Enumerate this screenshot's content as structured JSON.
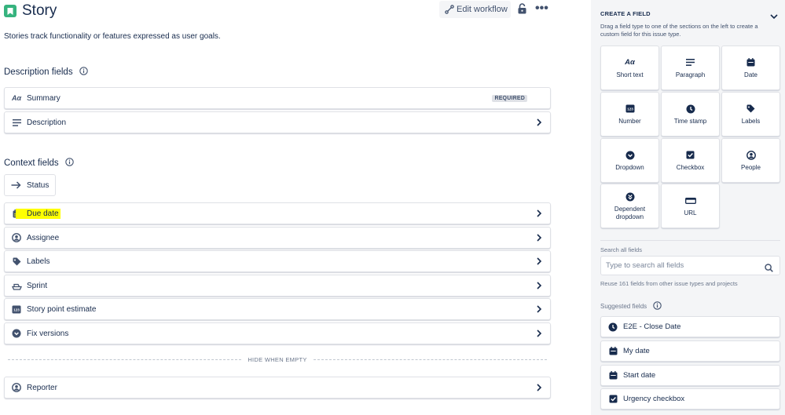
{
  "header": {
    "title": "Story",
    "edit_workflow_label": "Edit workflow",
    "subtitle": "Stories track functionality or features expressed as user goals."
  },
  "description_fields": {
    "title": "Description fields",
    "items": [
      {
        "label": "Summary",
        "icon": "text-aa-icon",
        "badge": "REQUIRED"
      },
      {
        "label": "Description",
        "icon": "paragraph-icon"
      }
    ]
  },
  "context_fields": {
    "title": "Context fields",
    "status_label": "Status",
    "items": [
      {
        "label": "Due date",
        "icon": "calendar-icon",
        "highlighted": true
      },
      {
        "label": "Assignee",
        "icon": "person-icon"
      },
      {
        "label": "Labels",
        "icon": "tag-icon"
      },
      {
        "label": "Sprint",
        "icon": "sprint-icon"
      },
      {
        "label": "Story point estimate",
        "icon": "number-icon"
      },
      {
        "label": "Fix versions",
        "icon": "chevron-circle-icon"
      }
    ],
    "hide_when_empty_label": "HIDE WHEN EMPTY",
    "hidden_items": [
      {
        "label": "Reporter",
        "icon": "person-icon"
      }
    ]
  },
  "create_field": {
    "title": "CREATE A FIELD",
    "description": "Drag a field type to one of the sections on the left to create a custom field for this issue type.",
    "types": [
      {
        "label": "Short text",
        "icon": "text-aa-icon"
      },
      {
        "label": "Paragraph",
        "icon": "paragraph-icon"
      },
      {
        "label": "Date",
        "icon": "calendar-icon"
      },
      {
        "label": "Number",
        "icon": "number-icon"
      },
      {
        "label": "Time stamp",
        "icon": "clock-icon"
      },
      {
        "label": "Labels",
        "icon": "tag-icon"
      },
      {
        "label": "Dropdown",
        "icon": "dropdown-icon"
      },
      {
        "label": "Checkbox",
        "icon": "checkbox-icon"
      },
      {
        "label": "People",
        "icon": "person-icon"
      },
      {
        "label": "Dependent dropdown",
        "icon": "double-chevron-icon"
      },
      {
        "label": "URL",
        "icon": "url-icon"
      }
    ]
  },
  "search": {
    "label": "Search all fields",
    "placeholder": "Type to search all fields",
    "reuse_text": "Reuse 161 fields from other issue types and projects"
  },
  "suggested": {
    "title": "Suggested fields",
    "items": [
      {
        "label": "E2E - Close Date",
        "icon": "clock-icon"
      },
      {
        "label": "My date",
        "icon": "calendar-icon"
      },
      {
        "label": "Start date",
        "icon": "calendar-icon"
      },
      {
        "label": "Urgency checkbox",
        "icon": "checkbox-icon"
      }
    ]
  },
  "colors": {
    "brand_story": "#36b37e",
    "text": "#172b4d",
    "border": "#dfe1e6",
    "highlight": "#ffff00",
    "panel_bg": "#f4f5f7"
  }
}
